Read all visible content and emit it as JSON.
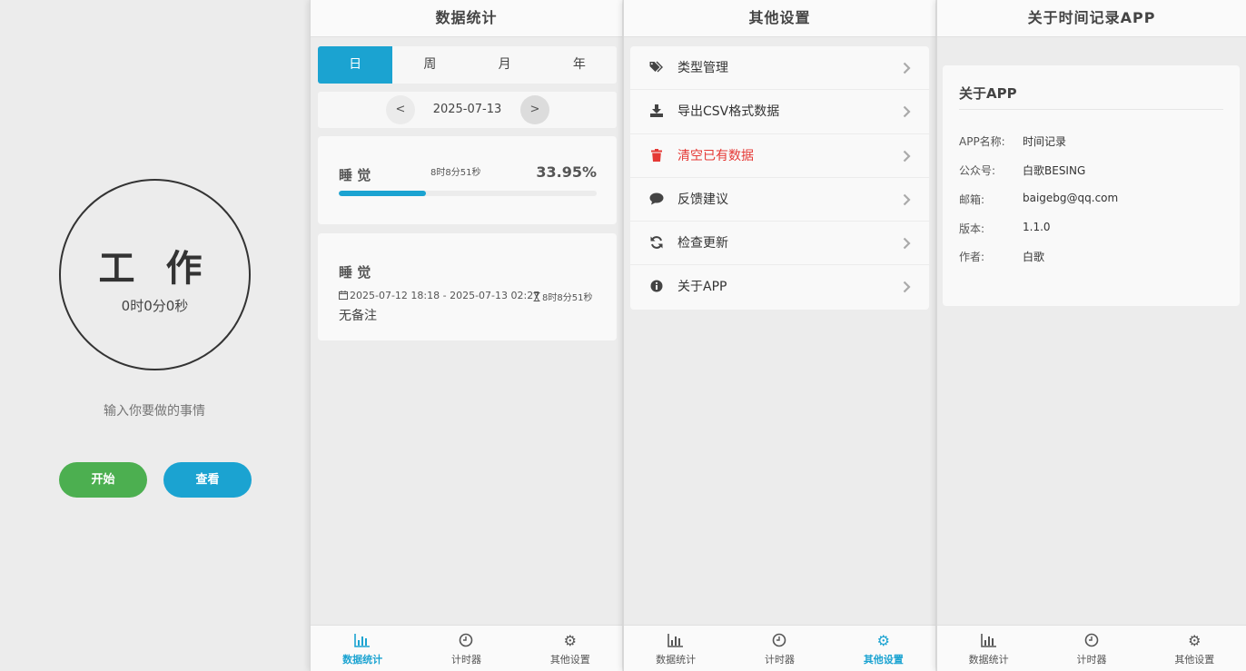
{
  "timer": {
    "title": "工 作",
    "elapsed": "0时0分0秒",
    "task_placeholder": "输入你要做的事情",
    "start_label": "开始",
    "view_label": "查看"
  },
  "stats": {
    "header": "数据统计",
    "tabs": [
      "日",
      "周",
      "月",
      "年"
    ],
    "active_tab": "日",
    "prev": "<",
    "next": ">",
    "date": "2025-07-13",
    "summary": {
      "name": "睡 觉",
      "duration": "8时8分51秒",
      "percent": "33.95%",
      "progress": 0.3395
    },
    "record": {
      "name": "睡 觉",
      "range": "2025-07-12 18:18 - 2025-07-13 02:27",
      "duration": "8时8分51秒",
      "note": "无备注"
    }
  },
  "settings": {
    "header": "其他设置",
    "items": [
      {
        "label": "类型管理",
        "icon": "tags-icon"
      },
      {
        "label": "导出CSV格式数据",
        "icon": "download-icon"
      },
      {
        "label": "清空已有数据",
        "icon": "trash-icon",
        "color": "#e53935"
      },
      {
        "label": "反馈建议",
        "icon": "comment-icon"
      },
      {
        "label": "检查更新",
        "icon": "refresh-icon"
      },
      {
        "label": "关于APP",
        "icon": "info-icon"
      }
    ]
  },
  "about": {
    "header": "关于时间记录APP",
    "title": "关于APP",
    "rows": [
      {
        "label": "APP名称:",
        "value": "时间记录"
      },
      {
        "label": "公众号:",
        "value": "白歌BESING"
      },
      {
        "label": "邮箱:",
        "value": "baigebg@qq.com"
      },
      {
        "label": "版本:",
        "value": "1.1.0"
      },
      {
        "label": "作者:",
        "value": "白歌"
      }
    ]
  },
  "nav": {
    "stats": "数据统计",
    "timer": "计时器",
    "settings": "其他设置"
  },
  "colors": {
    "accent": "#1ba3d1",
    "start": "#4caf50",
    "danger": "#e53935"
  }
}
